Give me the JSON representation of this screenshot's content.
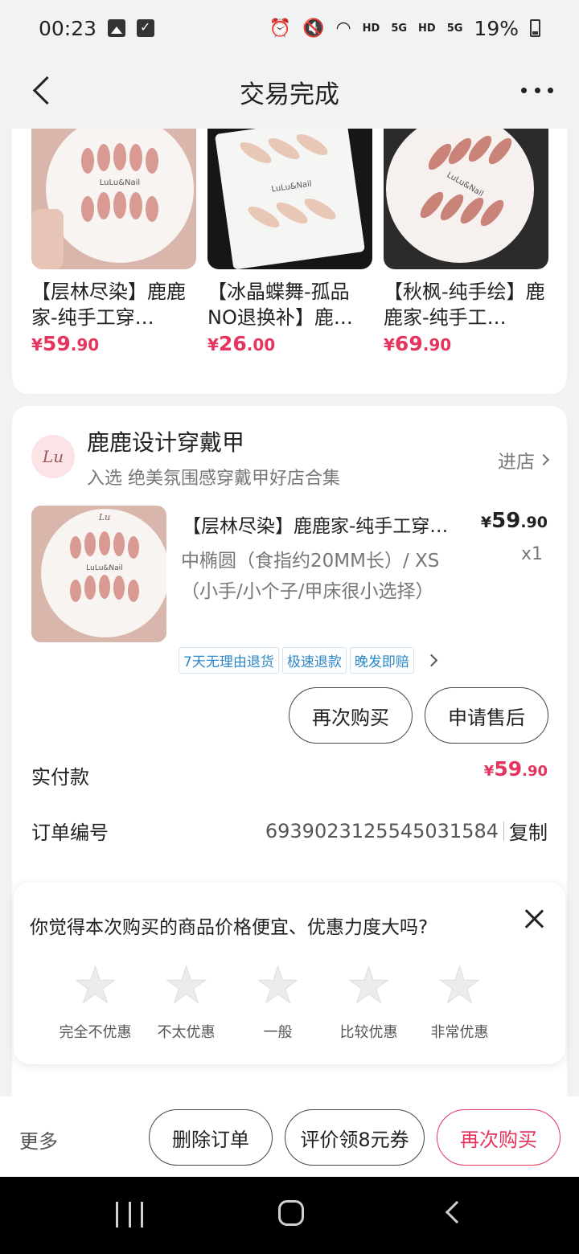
{
  "status_bar": {
    "time": "00:23",
    "hd1": "HD",
    "net1": "5G",
    "hd2": "HD",
    "net2": "5G",
    "battery": "19%"
  },
  "nav": {
    "title": "交易完成"
  },
  "recommendations": [
    {
      "title": "【层林尽染】鹿鹿家-纯手工穿…",
      "currency": "¥",
      "price_int": "59",
      "price_dec": ".90"
    },
    {
      "title": "【冰晶蝶舞-孤品NO退换补】鹿…",
      "currency": "¥",
      "price_int": "26",
      "price_dec": ".00"
    },
    {
      "title": "【秋枫-纯手绘】鹿鹿家-纯手工…",
      "currency": "¥",
      "price_int": "69",
      "price_dec": ".90"
    }
  ],
  "shop": {
    "logo_text": "Lu",
    "name": "鹿鹿设计穿戴甲",
    "tag": "入选 绝美氛围感穿戴甲好店合集",
    "enter_label": "进店"
  },
  "product": {
    "title": "【层林尽染】鹿鹿家-纯手工穿…",
    "currency": "¥",
    "price_int": "59",
    "price_dec": ".90",
    "spec": "中椭圆（食指约20MM长）/ XS（小手/小个子/甲床很小选择）",
    "qty": "x1",
    "badges": [
      "7天无理由退货",
      "极速退款",
      "晚发即赔"
    ]
  },
  "order_actions": {
    "buy_again": "再次购买",
    "after_sale": "申请售后"
  },
  "payment": {
    "label": "实付款",
    "currency": "¥",
    "int": "59",
    "dec": ".90"
  },
  "order_number": {
    "label": "订单编号",
    "value": "6939023125545031584",
    "copy": "复制"
  },
  "survey": {
    "question": "你觉得本次购买的商品价格便宜、优惠力度大吗?",
    "options": [
      "完全不优惠",
      "不太优惠",
      "一般",
      "比较优惠",
      "非常优惠"
    ]
  },
  "bottom_bar": {
    "more": "更多",
    "delete": "删除订单",
    "review": "评价领8元券",
    "buy_again": "再次购买"
  },
  "colors": {
    "accent": "#e5345d",
    "badge": "#2b87c9",
    "background": "#f1f2f4"
  }
}
